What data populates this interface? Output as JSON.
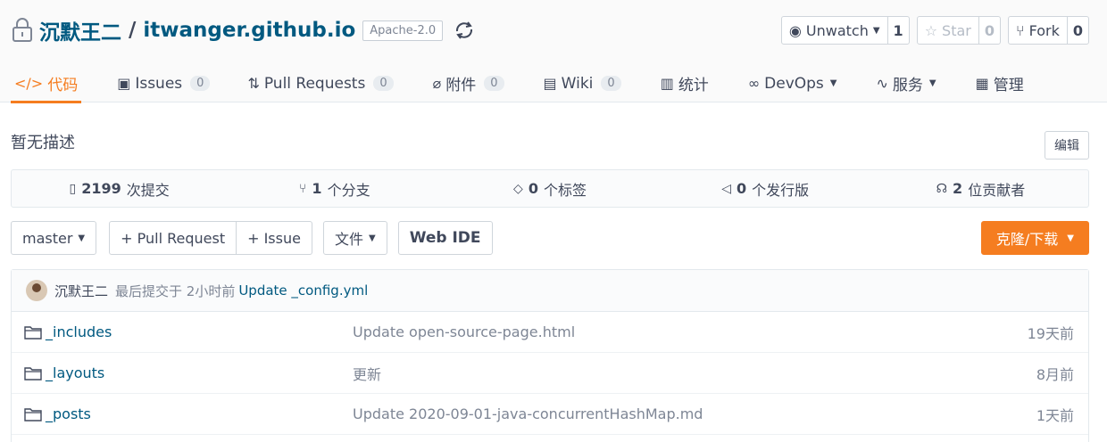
{
  "repo": {
    "owner": "沉默王二",
    "separator": "/",
    "name": "itwanger.github.io",
    "license": "Apache-2.0"
  },
  "actions": {
    "watch": {
      "label": "Unwatch",
      "count": "1"
    },
    "star": {
      "label": "Star",
      "count": "0"
    },
    "fork": {
      "label": "Fork",
      "count": "0"
    }
  },
  "tabs": [
    {
      "label": "代码",
      "icon": "code-icon",
      "active": true
    },
    {
      "label": "Issues",
      "badge": "0",
      "icon": "issues-icon"
    },
    {
      "label": "Pull Requests",
      "badge": "0",
      "icon": "pull-request-icon"
    },
    {
      "label": "附件",
      "badge": "0",
      "icon": "paperclip-icon"
    },
    {
      "label": "Wiki",
      "badge": "0",
      "icon": "book-icon"
    },
    {
      "label": "统计",
      "icon": "bar-chart-icon"
    },
    {
      "label": "DevOps",
      "icon": "infinity-icon"
    },
    {
      "label": "服务",
      "icon": "pulse-icon"
    },
    {
      "label": "管理",
      "icon": "manage-icon"
    }
  ],
  "description": "暂无描述",
  "edit_label": "编辑",
  "stats": {
    "commits": {
      "count": "2199",
      "label": "次提交"
    },
    "branches": {
      "count": "1",
      "label": "个分支"
    },
    "tags": {
      "count": "0",
      "label": "个标签"
    },
    "releases": {
      "count": "0",
      "label": "个发行版"
    },
    "contributors": {
      "count": "2",
      "label": "位贡献者"
    }
  },
  "toolbar": {
    "branch": "master",
    "pull_request": "+ Pull Request",
    "issue": "+ Issue",
    "file": "文件",
    "webide": "Web IDE",
    "clone": "克隆/下载"
  },
  "last_commit": {
    "author": "沉默王二",
    "meta": "最后提交于 2小时前",
    "message": "Update _config.yml"
  },
  "files": [
    {
      "name": "_includes",
      "message": "Update open-source-page.html",
      "time": "19天前"
    },
    {
      "name": "_layouts",
      "message": "更新",
      "time": "8月前"
    },
    {
      "name": "_posts",
      "message": "Update 2020-09-01-java-concurrentHashMap.md",
      "time": "1天前"
    }
  ],
  "colors": {
    "accent": "#f57d20",
    "link": "#005980",
    "text": "#40485b"
  }
}
